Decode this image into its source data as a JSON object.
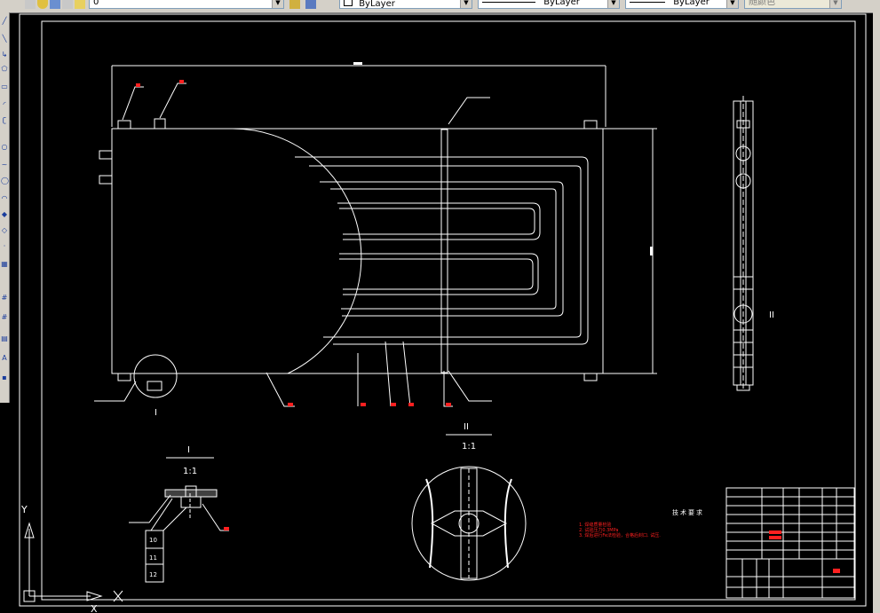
{
  "toolbar": {
    "layer_value": "0",
    "color_value": "ByLayer",
    "linetype_value": "ByLayer",
    "lineweight_value": "ByLayer",
    "plotstyle_value": "随颜色"
  },
  "drawing": {
    "detail_I_label": "I",
    "detail_I_scale": "1:1",
    "detail_II_label": "II",
    "detail_II_scale": "1:1",
    "callout_I": "I",
    "callout_II": "II",
    "part_labels": [
      "10",
      "11",
      "12"
    ],
    "tech_title": "技术要求",
    "tech_notes": [
      "1. 焊缝质量检验",
      "2. 试验压力0.3MPa",
      "3. 焊后进行Fe法检验，合格后封口. 试压."
    ]
  },
  "ucs": {
    "x_label": "X",
    "y_label": "Y"
  },
  "colors": {
    "background": "#000000",
    "lines": "#ffffff",
    "annotation_red": "#ff2020",
    "toolbar": "#d4d0c8"
  }
}
